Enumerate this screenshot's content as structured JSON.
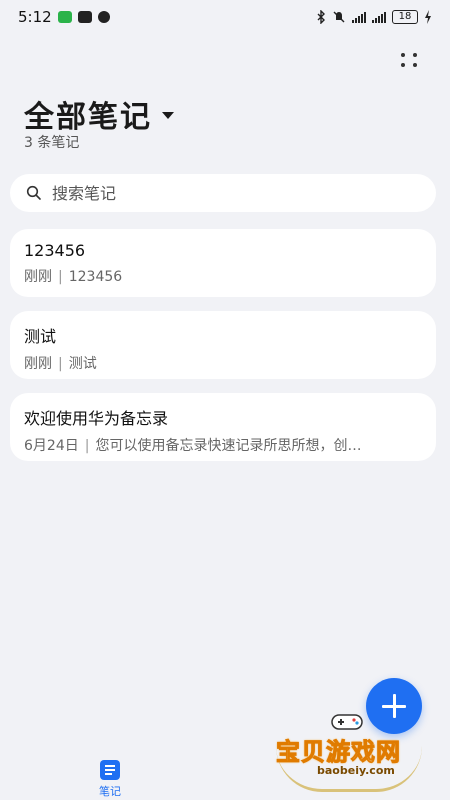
{
  "status_bar": {
    "time": "5:12",
    "battery": "18"
  },
  "header": {
    "title": "全部笔记",
    "count": "3 条笔记"
  },
  "search": {
    "placeholder": "搜索笔记"
  },
  "notes": [
    {
      "title": "123456",
      "time": "刚刚",
      "preview": "123456"
    },
    {
      "title": "测试",
      "time": "刚刚",
      "preview": "测试"
    },
    {
      "title": "欢迎使用华为备忘录",
      "time": "6月24日",
      "preview": "您可以使用备忘录快速记录所思所想，创…"
    }
  ],
  "bottom_nav": {
    "notes_label": "笔记"
  },
  "watermark": {
    "brand": "宝贝游戏网",
    "url": "baobeiy.com"
  },
  "colors": {
    "accent": "#1f6ff2",
    "background": "#f1f2f6",
    "card": "#ffffff"
  },
  "icons": [
    "wechat-icon",
    "nfc-icon",
    "alarm-icon",
    "bluetooth-icon",
    "mute-icon",
    "signal-icon",
    "battery-icon",
    "more-icon",
    "dropdown-caret-icon",
    "search-icon",
    "add-icon",
    "notes-icon"
  ]
}
